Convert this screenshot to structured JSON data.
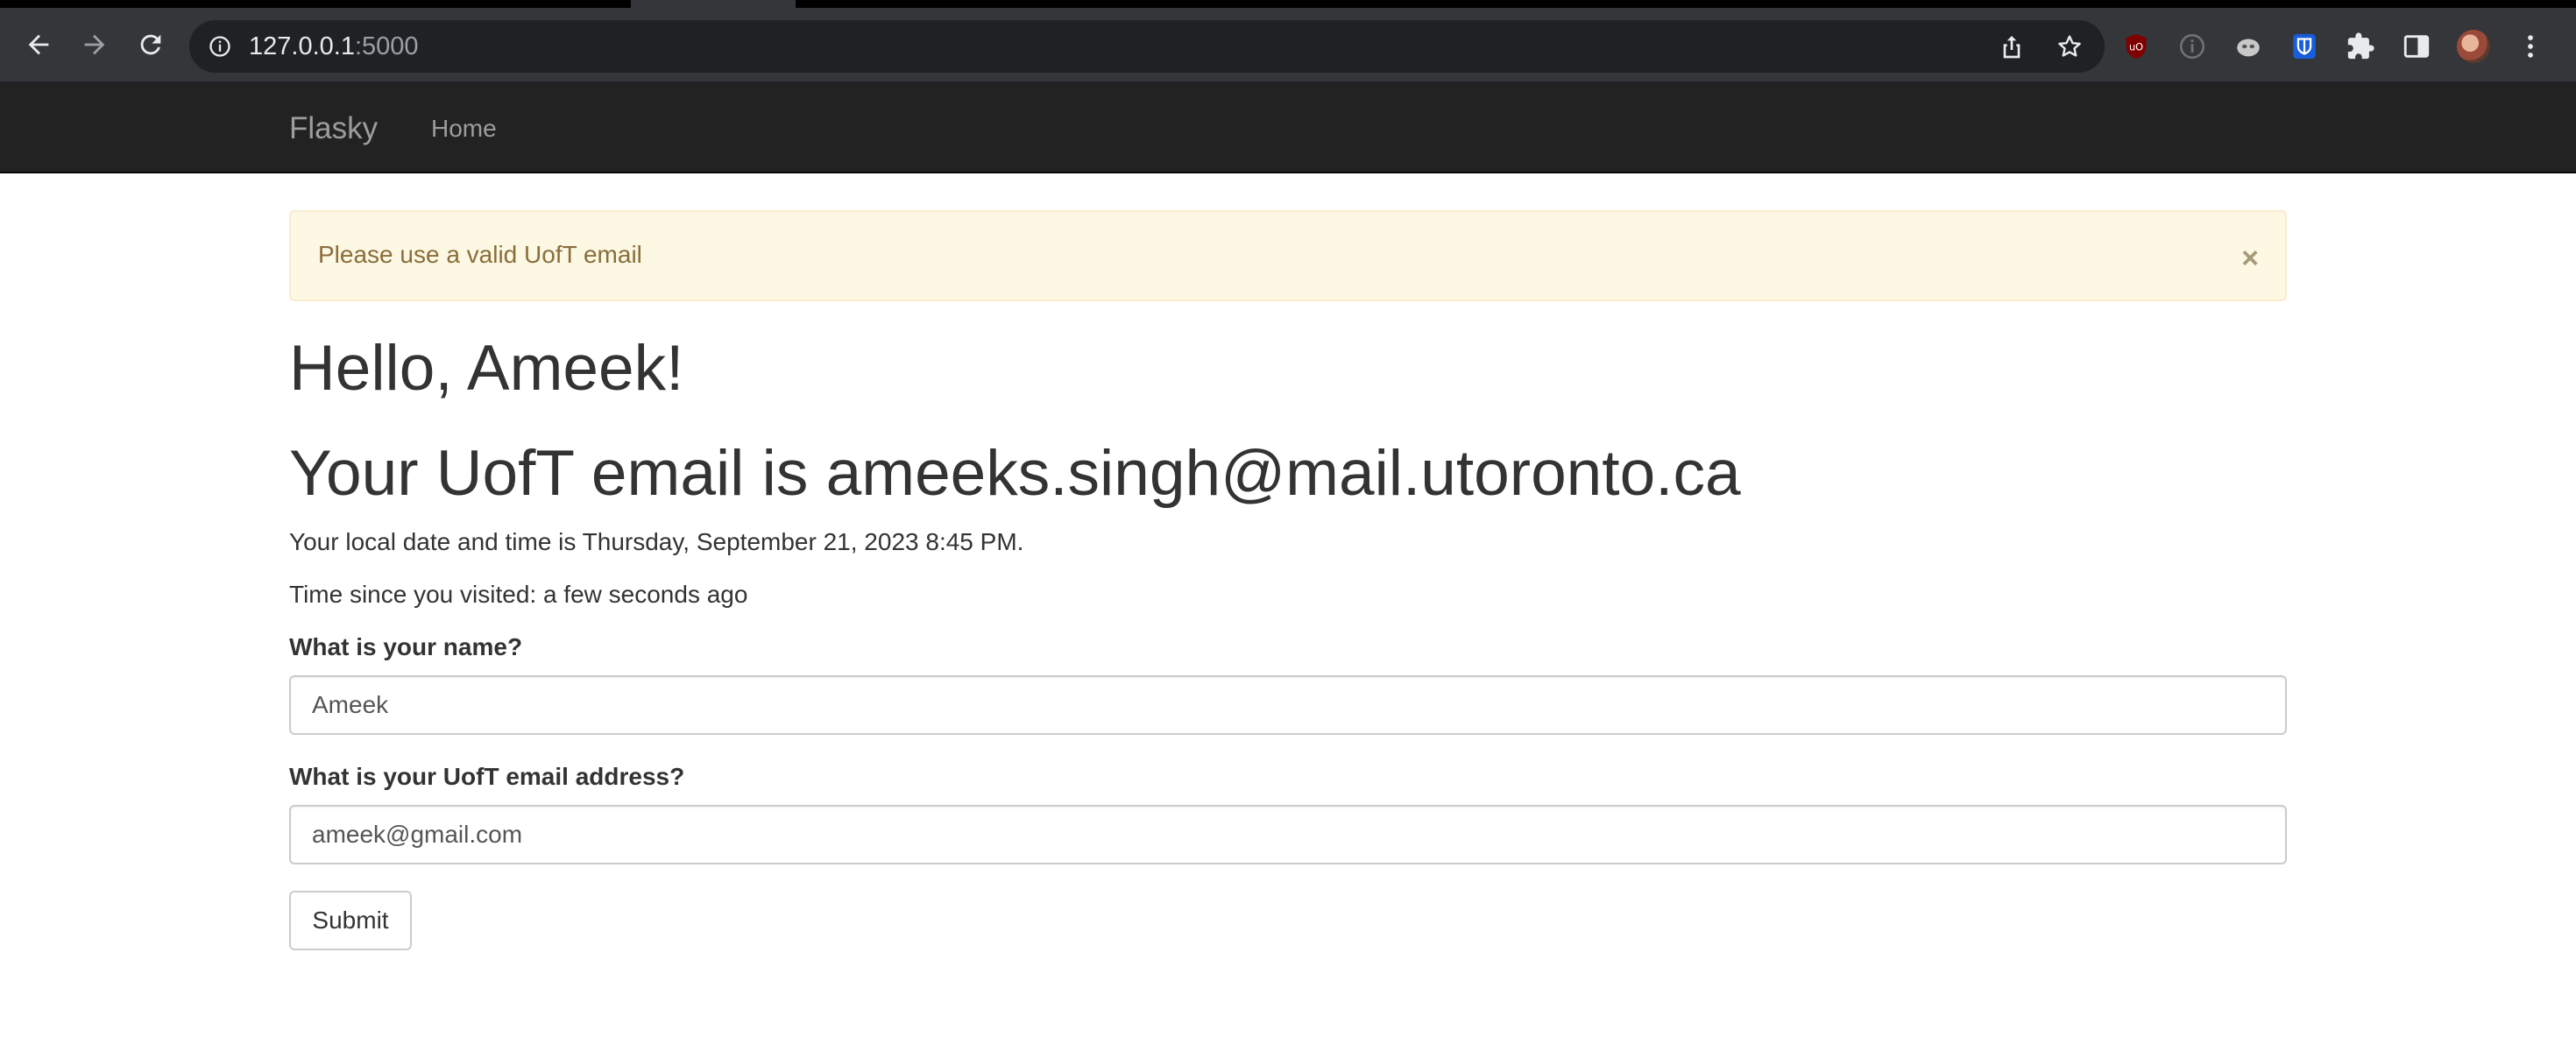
{
  "browser": {
    "url_host": "127.0.0.1",
    "url_port": ":5000",
    "icons": {
      "back": "back-arrow-icon",
      "forward": "forward-arrow-icon",
      "reload": "reload-icon",
      "site_info": "info-icon",
      "share": "share-icon",
      "bookmark": "star-icon",
      "extensions": [
        "ublock-icon",
        "info-extension-icon",
        "mask-extension-icon",
        "bitwarden-icon",
        "puzzle-icon",
        "side-panel-icon"
      ],
      "menu": "kebab-menu-icon"
    }
  },
  "navbar": {
    "brand": "Flasky",
    "links": [
      "Home"
    ]
  },
  "alert": {
    "message": "Please use a valid UofT email",
    "close": "×"
  },
  "main": {
    "greeting": "Hello, Ameek!",
    "email_heading": "Your UofT email is ameeks.singh@mail.utoronto.ca",
    "local_time": "Your local date and time is Thursday, September 21, 2023 8:45 PM.",
    "since_visit": "Time since you visited: a few seconds ago"
  },
  "form": {
    "name_label": "What is your name?",
    "name_value": "Ameek",
    "email_label": "What is your UofT email address?",
    "email_value": "ameek@gmail.com",
    "submit_label": "Submit"
  },
  "colors": {
    "navbar_bg": "#222222",
    "alert_bg": "#fcf8e3",
    "alert_text": "#8a6d3b",
    "browser_toolbar": "#35363a"
  }
}
